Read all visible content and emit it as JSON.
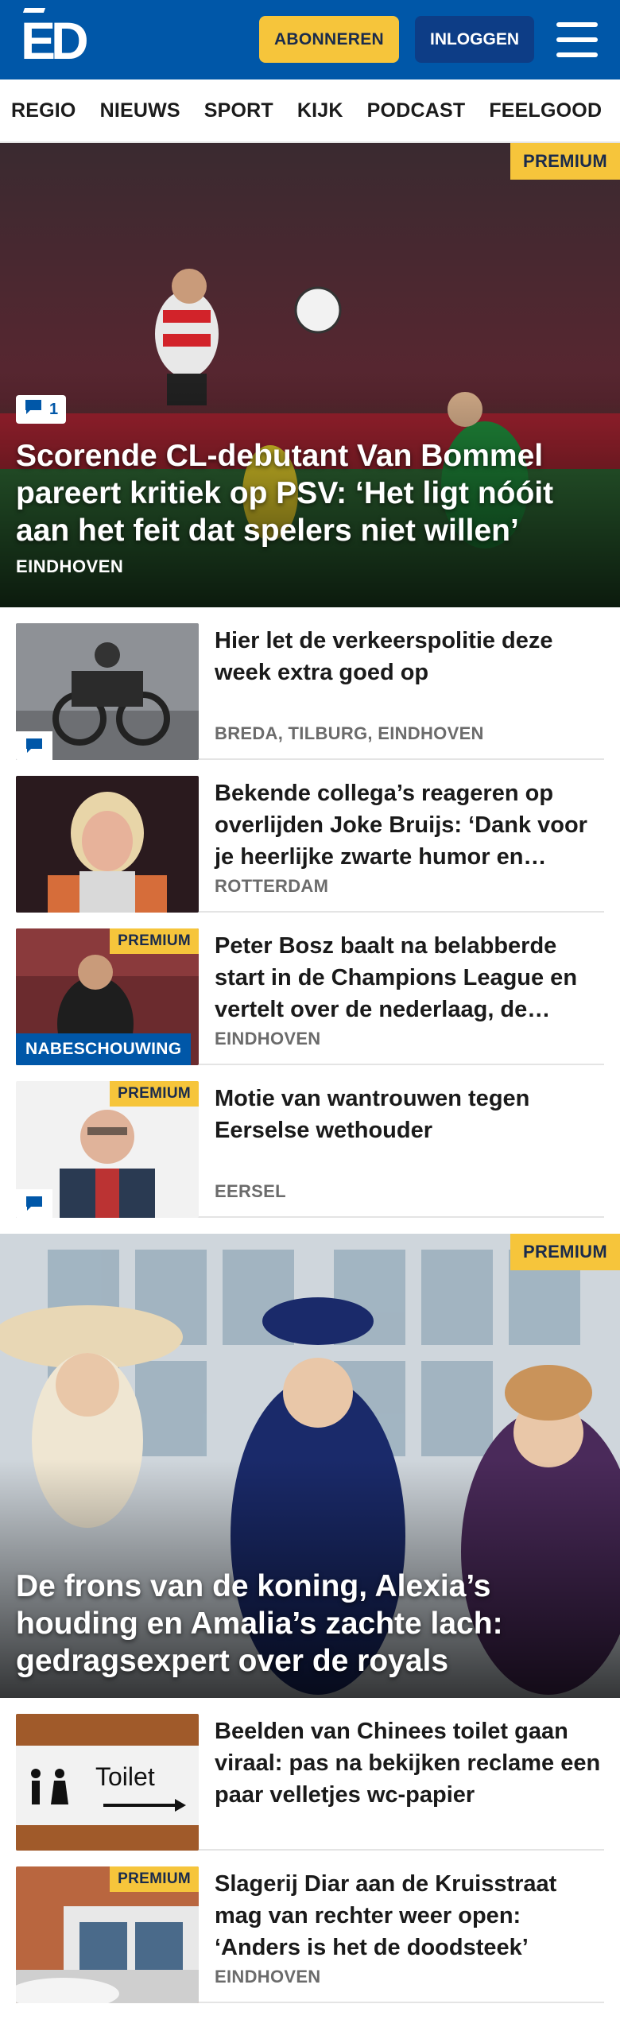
{
  "header": {
    "logo": "ED",
    "subscribe_label": "ABONNEREN",
    "login_label": "INLOGGEN"
  },
  "nav": {
    "items": [
      "REGIO",
      "NIEUWS",
      "SPORT",
      "KIJK",
      "PODCAST",
      "FEELGOOD"
    ]
  },
  "hero1": {
    "premium": "PREMIUM",
    "comments": "1",
    "title": "Scorende CL-debutant Van Bommel pareert kritiek op PSV: ‘Het ligt nóóit aan het feit dat spelers niet willen’",
    "location": "EINDHOVEN"
  },
  "articles1": [
    {
      "title": "Hier let de verkeerspolitie deze week extra goed op",
      "location": "BREDA, TILBURG, EINDHOVEN"
    },
    {
      "title": "Bekende collega’s reageren op overlijden Joke Bruijs: ‘Dank voor je heerlijke zwarte humor en…",
      "location": "ROTTERDAM"
    },
    {
      "title": "Peter Bosz baalt na belabberde start in de Champions League en vertelt over de nederlaag, de…",
      "location": "EINDHOVEN",
      "premium": "PREMIUM",
      "label": "NABESCHOUWING"
    },
    {
      "title": "Motie van wantrouwen tegen Eerselse wethouder",
      "location": "EERSEL",
      "premium": "PREMIUM"
    }
  ],
  "hero2": {
    "premium": "PREMIUM",
    "title": "De frons van de koning, Alexia’s houding en Amalia’s zachte lach: gedragsexpert over de royals"
  },
  "articles2": [
    {
      "title": "Beelden van Chinees toilet gaan viraal: pas na bekijken reclame een paar velletjes wc-papier",
      "sign_text": "Toilet"
    },
    {
      "title": "Slagerij Diar aan de Kruisstraat mag van rechter weer open: ‘Anders is het de doodsteek’",
      "location": "EINDHOVEN",
      "premium": "PREMIUM"
    }
  ],
  "colors": {
    "brand_blue": "#0057a8",
    "premium_yellow": "#f6c53b",
    "login_blue": "#0d3d86"
  }
}
